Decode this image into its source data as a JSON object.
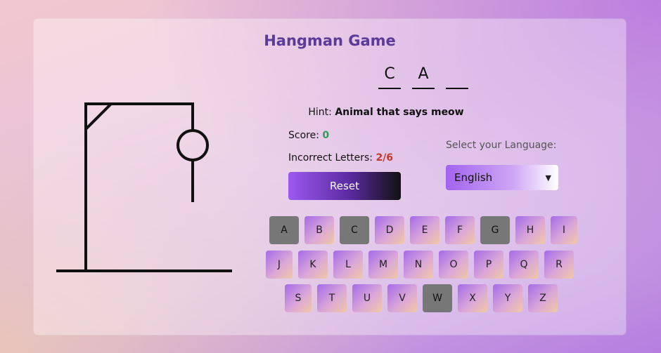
{
  "title": "Hangman Game",
  "word_slots": [
    "C",
    "A",
    ""
  ],
  "hint": {
    "label": "Hint:",
    "text": "Animal that says meow"
  },
  "score": {
    "label": "Score:",
    "value": "0"
  },
  "incorrect": {
    "label": "Incorrect Letters:",
    "value": "2/6"
  },
  "reset_label": "Reset",
  "language": {
    "label": "Select your Language:",
    "selected": "English"
  },
  "keyboard": {
    "row1": [
      "A",
      "B",
      "C",
      "D",
      "E",
      "F",
      "G",
      "H",
      "I"
    ],
    "row2": [
      "J",
      "K",
      "L",
      "M",
      "N",
      "O",
      "P",
      "Q",
      "R"
    ],
    "row3": [
      "S",
      "T",
      "U",
      "V",
      "W",
      "X",
      "Y",
      "Z"
    ],
    "used": [
      "A",
      "C",
      "G",
      "W"
    ]
  },
  "colors": {
    "title": "#5b3a9a",
    "score": "#2e9e55",
    "incorrect": "#c0392b",
    "used_key": "#777777"
  }
}
